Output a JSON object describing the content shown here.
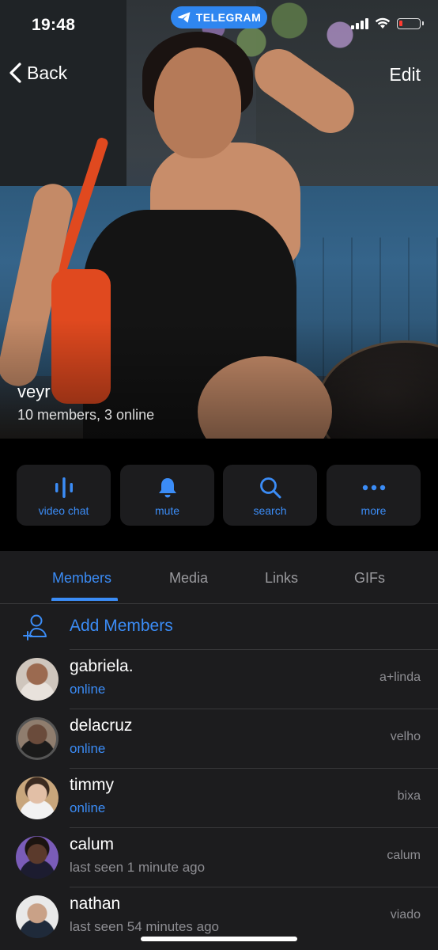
{
  "status_bar": {
    "time": "19:48",
    "app_pill": "TELEGRAM"
  },
  "header": {
    "back_label": "Back",
    "edit_label": "Edit"
  },
  "group": {
    "name": "veyr",
    "subtitle": "10 members, 3 online"
  },
  "actions": [
    {
      "label": "video chat",
      "icon": "waveform-icon"
    },
    {
      "label": "mute",
      "icon": "bell-icon"
    },
    {
      "label": "search",
      "icon": "search-icon"
    },
    {
      "label": "more",
      "icon": "ellipsis-icon"
    }
  ],
  "tabs": [
    {
      "label": "Members",
      "active": true
    },
    {
      "label": "Media",
      "active": false
    },
    {
      "label": "Links",
      "active": false
    },
    {
      "label": "GIFs",
      "active": false
    }
  ],
  "add_members": {
    "label": "Add Members",
    "icon": "add-person-icon"
  },
  "members": [
    {
      "name": "gabriela.",
      "status": "online",
      "online": true,
      "role": "a+linda"
    },
    {
      "name": "delacruz",
      "status": "online",
      "online": true,
      "role": "velho"
    },
    {
      "name": "timmy",
      "status": "online",
      "online": true,
      "role": "bixa"
    },
    {
      "name": "calum",
      "status": "last seen 1 minute ago",
      "online": false,
      "role": "calum"
    },
    {
      "name": "nathan",
      "status": "last seen 54 minutes ago",
      "online": false,
      "role": "viado"
    }
  ],
  "colors": {
    "accent": "#3b8cf6",
    "background": "#1c1c1e",
    "pill": "#2f86f0",
    "battery_low": "#ff3b30"
  }
}
